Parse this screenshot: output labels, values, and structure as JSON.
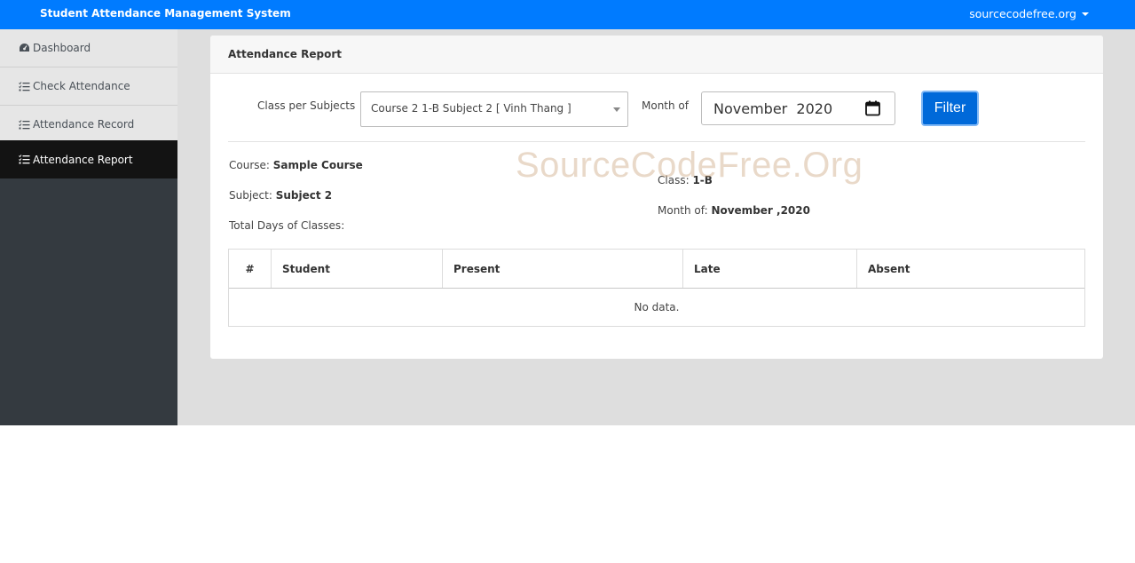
{
  "app": {
    "title": "Student Attendance Management System",
    "user_menu": "sourcecodefree.org"
  },
  "sidebar": {
    "items": [
      {
        "label": "Dashboard",
        "icon": "tachometer-icon",
        "active": false
      },
      {
        "label": "Check Attendance",
        "icon": "list-check-icon",
        "active": false
      },
      {
        "label": "Attendance Record",
        "icon": "list-check-icon",
        "active": false
      },
      {
        "label": "Attendance Report",
        "icon": "list-check-icon",
        "active": true
      }
    ]
  },
  "card": {
    "title": "Attendance Report"
  },
  "filters": {
    "class_label": "Class per Subjects",
    "class_value": "Course 2 1-B Subject 2 [ Vinh Thang ]",
    "month_label": "Month of",
    "month_value": "November  2020",
    "filter_button": "Filter"
  },
  "info": {
    "course_label": "Course:",
    "course_value": "Sample Course",
    "subject_label": "Subject:",
    "subject_value": "Subject 2",
    "total_days_label": "Total Days of Classes:",
    "class_label": "Class:",
    "class_value": "1-B",
    "month_label": "Month of:",
    "month_value": "November ,2020"
  },
  "watermark": "SourceCodeFree.Org",
  "table": {
    "columns": [
      "#",
      "Student",
      "Present",
      "Late",
      "Absent"
    ],
    "empty_text": "No data."
  },
  "colors": {
    "topbar": "#007bff",
    "sidebar": "#343a40",
    "active_item": "#131313",
    "button": "#0069d9"
  }
}
